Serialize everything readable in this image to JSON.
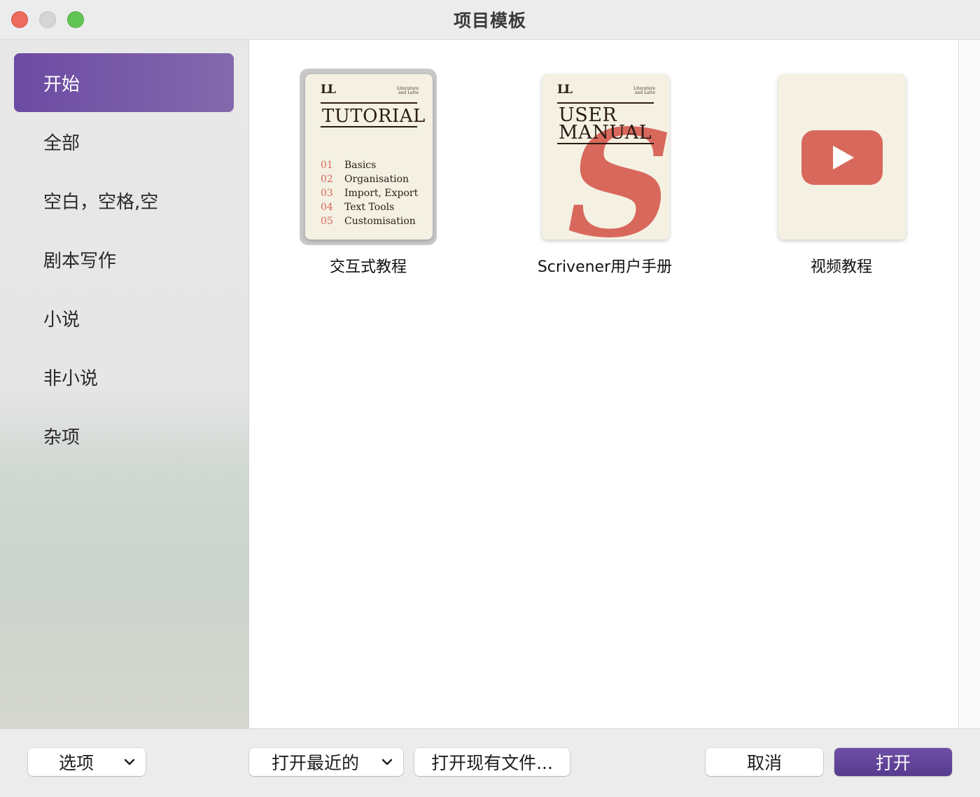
{
  "window": {
    "title": "项目模板"
  },
  "sidebar": {
    "items": [
      {
        "label": "开始",
        "active": true
      },
      {
        "label": "全部"
      },
      {
        "label": "空白，空格,空"
      },
      {
        "label": "剧本写作"
      },
      {
        "label": "小说"
      },
      {
        "label": "非小说"
      },
      {
        "label": "杂项"
      }
    ]
  },
  "templates": [
    {
      "label": "交互式教程",
      "selected": true,
      "cover": {
        "logo": "LL",
        "publisher_line1": "Literature",
        "publisher_line2": "and Latte",
        "title": "TUTORIAL",
        "toc": [
          {
            "num": "01",
            "text": "Basics"
          },
          {
            "num": "02",
            "text": "Organisation"
          },
          {
            "num": "03",
            "text": "Import, Export"
          },
          {
            "num": "04",
            "text": "Text Tools"
          },
          {
            "num": "05",
            "text": "Customisation"
          }
        ]
      }
    },
    {
      "label": "Scrivener用户手册",
      "cover": {
        "logo": "LL",
        "publisher_line1": "Literature",
        "publisher_line2": "and Latte",
        "title_line1": "USER",
        "title_line2": "MANUAL",
        "accent_glyph": "S"
      }
    },
    {
      "label": "视频教程",
      "cover": {
        "icon": "play-video-icon"
      }
    }
  ],
  "footer": {
    "options_label": "选项",
    "open_recent_label": "打开最近的",
    "open_existing_label": "打开现有文件...",
    "cancel_label": "取消",
    "open_label": "打开"
  },
  "colors": {
    "accent": "#6c4ba3",
    "cover_red": "#d9685c",
    "cover_paper": "#f4f1e3"
  }
}
